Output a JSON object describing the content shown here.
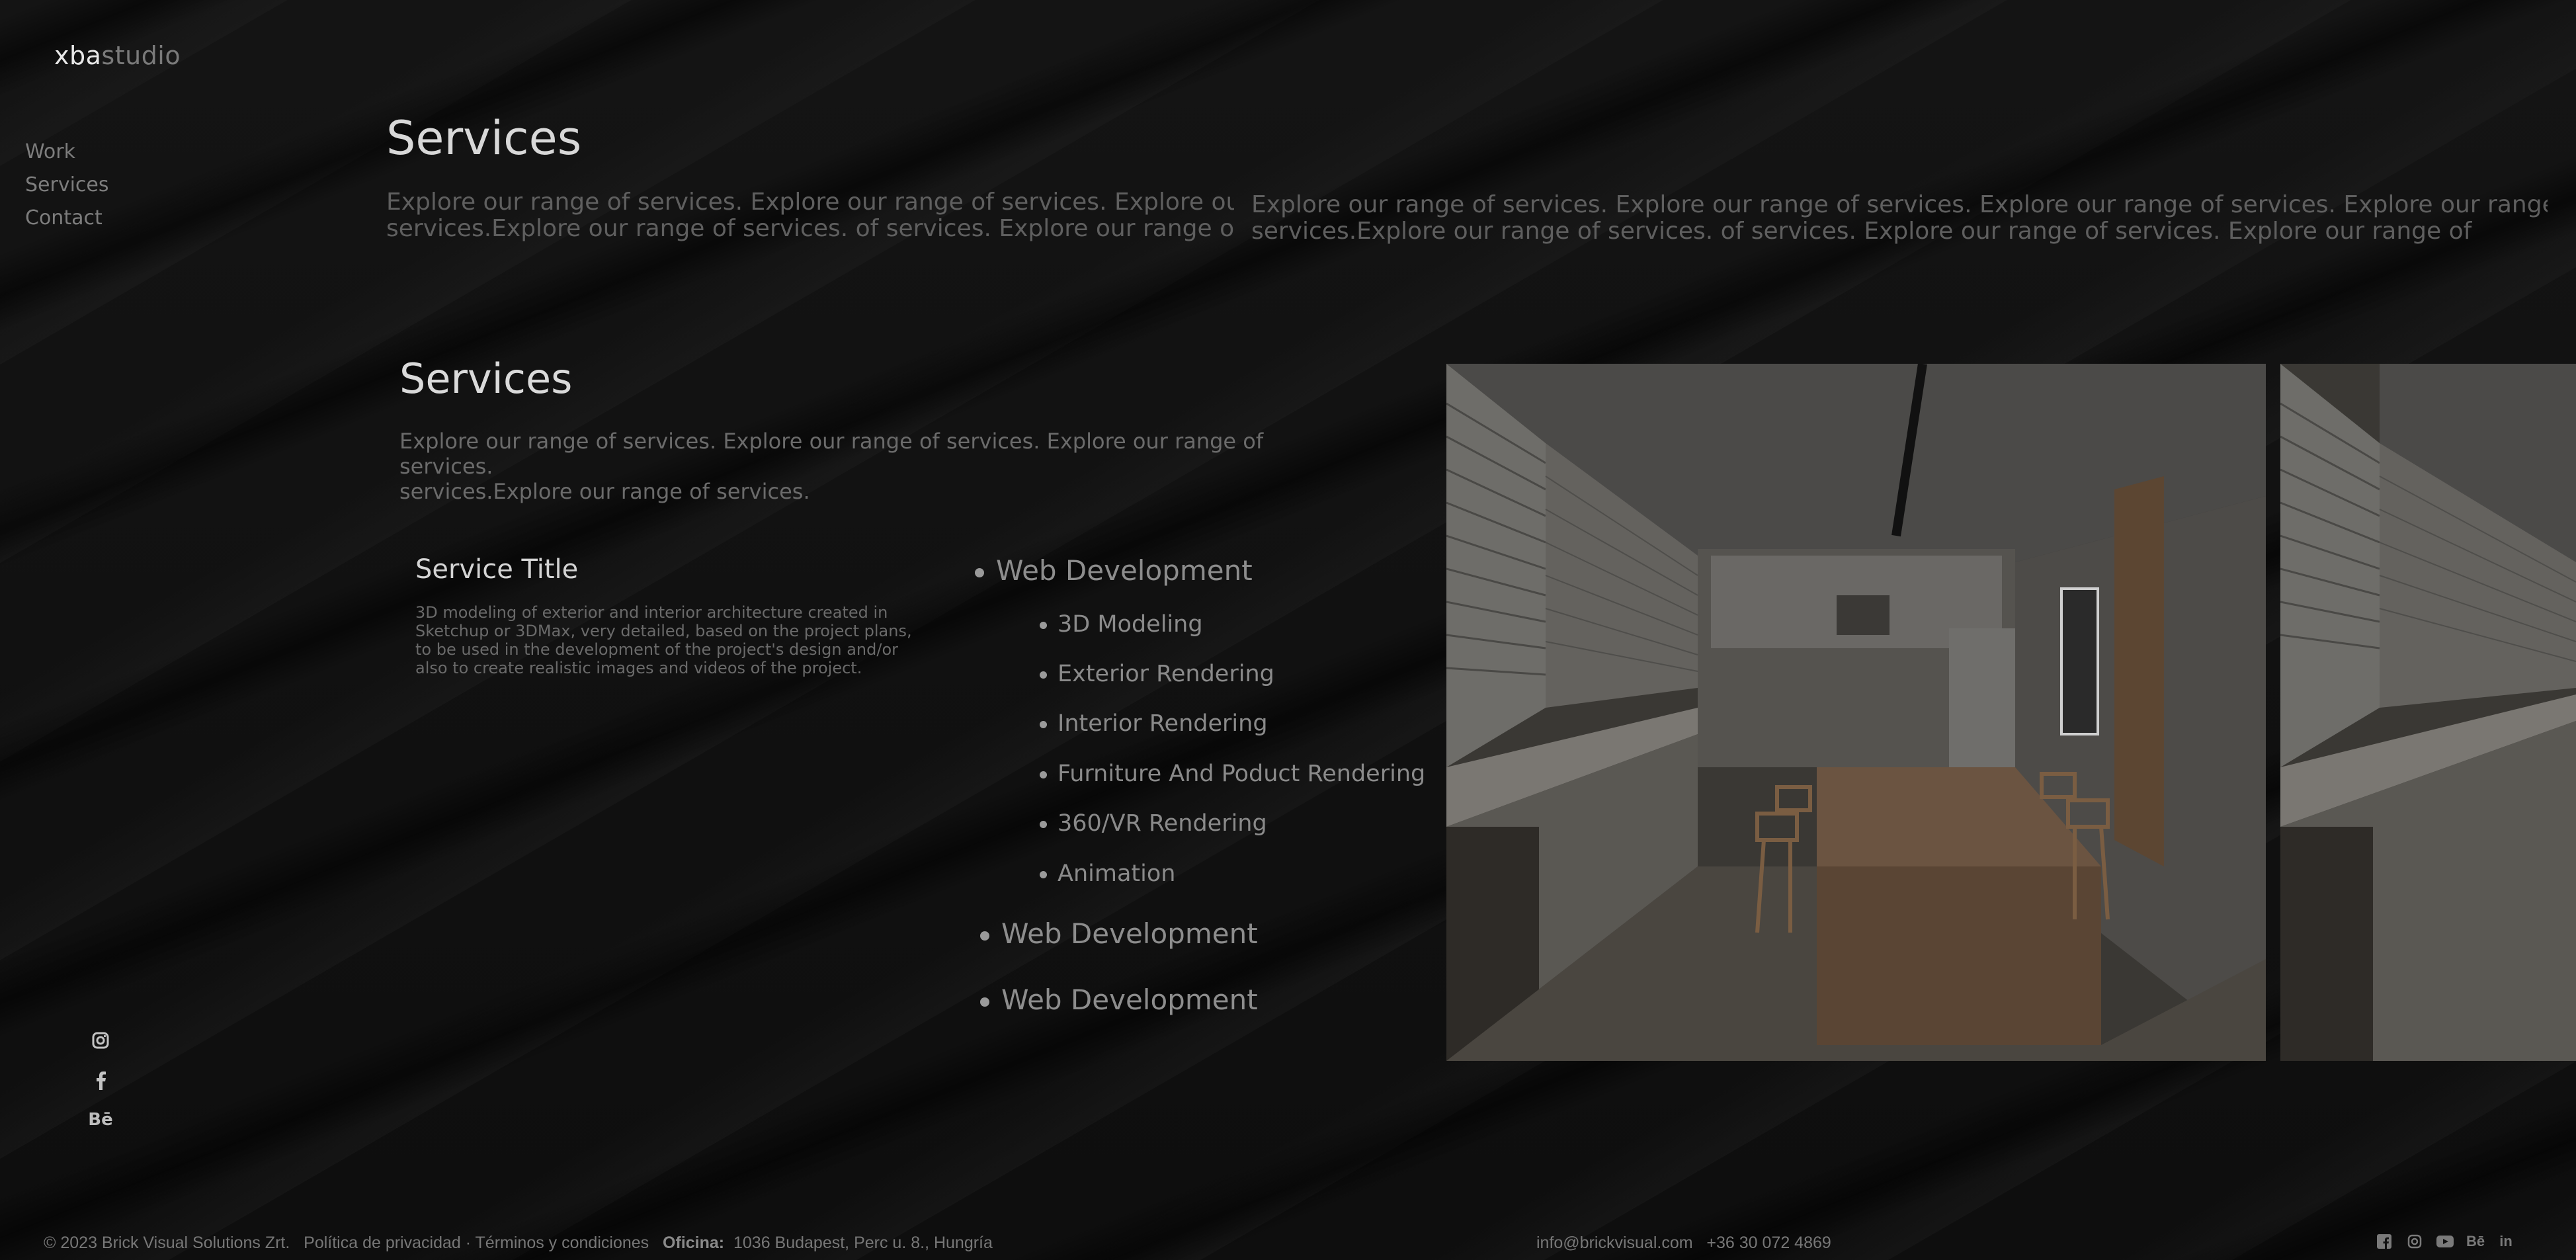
{
  "logo": {
    "bold": "xba",
    "light": "studio"
  },
  "nav": {
    "items": [
      {
        "label": "Work"
      },
      {
        "label": "Services"
      },
      {
        "label": "Contact"
      }
    ]
  },
  "hero": {
    "title": "Services",
    "left_line1": "Explore our range of services. Explore our range of services. Explore our range of",
    "left_line2": "services.Explore our range of services.  of services. Explore our range of services",
    "right_line1": "Explore our range of services. Explore our range of services. Explore our range of services. Explore our range of",
    "right_line2": "services.Explore our range of services.  of services. Explore our range of services. Explore our range of"
  },
  "services": {
    "title": "Services",
    "subtitle_line1": "Explore our range of services. Explore our range of services. Explore our range of services.",
    "subtitle_line2": "services.Explore our range of services.",
    "service_title": "Service Title",
    "service_desc": "3D modeling of exterior and interior architecture created in Sketchup or 3DMax, very detailed, based on the project plans, to be used in the development of the project's design and/or also to create realistic images and videos of the project.",
    "list": {
      "main_1": "Web Development",
      "sub": [
        "3D Modeling",
        "Exterior Rendering",
        "Interior Rendering",
        "Furniture And Poduct Rendering",
        "360/VR Rendering",
        "Animation"
      ],
      "main_2": "Web Development",
      "main_3": "Web Development"
    }
  },
  "social": {
    "icons": [
      "instagram-icon",
      "facebook-icon",
      "behance-icon"
    ],
    "behance_label": "Bē"
  },
  "footer": {
    "copyright": "© 2023 Brick Visual Solutions Zrt.",
    "legal": "Política de privacidad · Términos y condiciones",
    "office_label": "Oficina:",
    "office_address": "1036 Budapest, Perc u. 8., Hungría",
    "email": "info@brickvisual.com",
    "phone": "+36 30 072 4869",
    "icons": [
      "facebook-icon",
      "instagram-icon",
      "youtube-icon",
      "behance-icon",
      "linkedin-icon"
    ],
    "behance_label": "Bē",
    "linkedin_label": "in"
  },
  "colors": {
    "background": "#101010",
    "title": "#d8d8d8",
    "muted": "#6a6a6a"
  }
}
